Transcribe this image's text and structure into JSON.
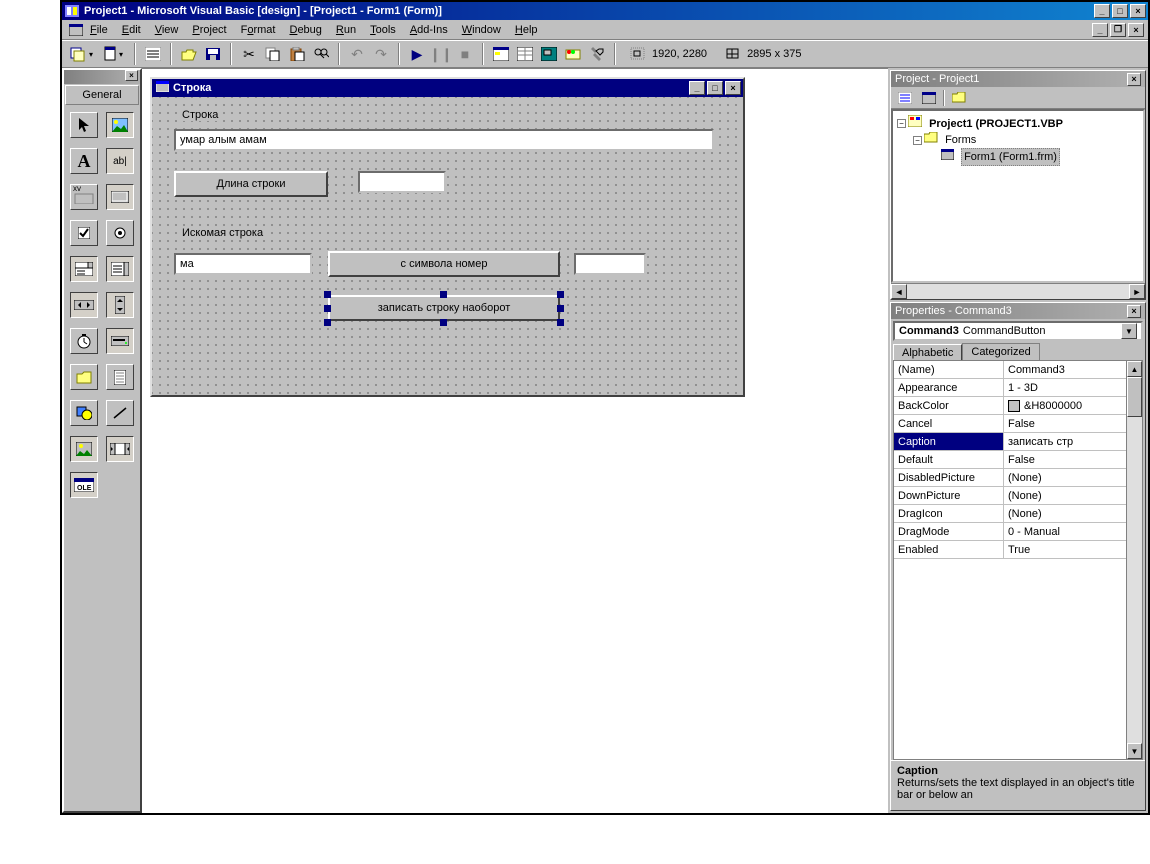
{
  "title": "Project1 - Microsoft Visual Basic [design] - [Project1 - Form1 (Form)]",
  "menu": [
    "File",
    "Edit",
    "View",
    "Project",
    "Format",
    "Debug",
    "Run",
    "Tools",
    "Add-Ins",
    "Window",
    "Help"
  ],
  "coords": {
    "pos": "1920, 2280",
    "size": "2895 x 375"
  },
  "toolbox": {
    "tab": "General"
  },
  "form": {
    "title": "Строка",
    "label_string": "Строка",
    "text_value": "умар алым амам",
    "btn_len": "Длина строки",
    "label_search": "Искомая строка",
    "search_value": "ма",
    "btn_from": "с символа номер",
    "btn_reverse": "записать строку наоборот"
  },
  "project_panel": {
    "title": "Project - Project1",
    "root": "Project1 (PROJECT1.VBP",
    "folder": "Forms",
    "item": "Form1 (Form1.frm)"
  },
  "props_panel": {
    "title": "Properties - Command3",
    "combo_name": "Command3",
    "combo_type": "CommandButton",
    "tab_alpha": "Alphabetic",
    "tab_cat": "Categorized",
    "rows": [
      {
        "k": "(Name)",
        "v": "Command3"
      },
      {
        "k": "Appearance",
        "v": "1 - 3D"
      },
      {
        "k": "BackColor",
        "v": "&H8000000",
        "swatch": true
      },
      {
        "k": "Cancel",
        "v": "False"
      },
      {
        "k": "Caption",
        "v": "записать стр",
        "sel": true
      },
      {
        "k": "Default",
        "v": "False"
      },
      {
        "k": "DisabledPicture",
        "v": "(None)"
      },
      {
        "k": "DownPicture",
        "v": "(None)"
      },
      {
        "k": "DragIcon",
        "v": "(None)"
      },
      {
        "k": "DragMode",
        "v": "0 - Manual"
      },
      {
        "k": "Enabled",
        "v": "True"
      }
    ],
    "desc_title": "Caption",
    "desc_text": "Returns/sets the text displayed in an object's title bar or below an"
  }
}
